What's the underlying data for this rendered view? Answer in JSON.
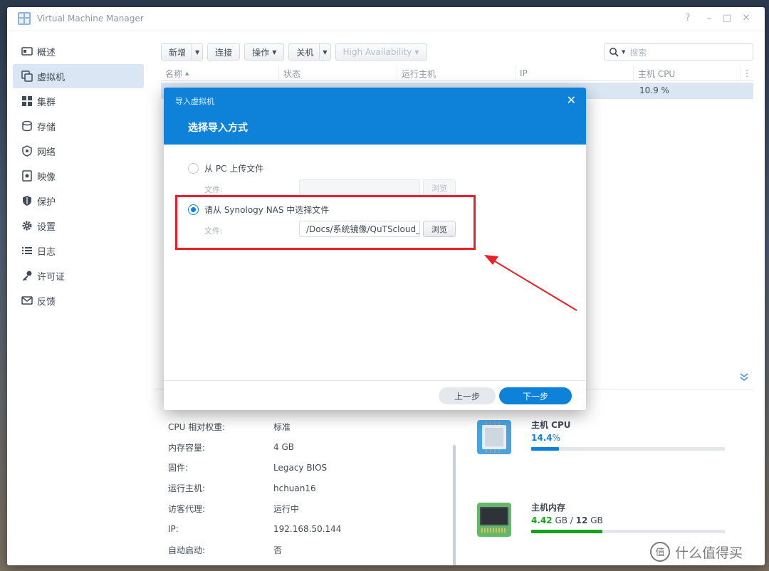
{
  "app": {
    "title": "Virtual Machine Manager"
  },
  "window_controls": {
    "help": "?",
    "minimize": "–",
    "maximize": "□",
    "close": "✕"
  },
  "sidebar": {
    "items": [
      {
        "label": "概述",
        "icon": "overview-icon",
        "active": false
      },
      {
        "label": "虚拟机",
        "icon": "virtual-machine-icon",
        "active": true
      },
      {
        "label": "集群",
        "icon": "cluster-icon",
        "active": false
      },
      {
        "label": "存储",
        "icon": "storage-icon",
        "active": false
      },
      {
        "label": "网络",
        "icon": "network-icon",
        "active": false
      },
      {
        "label": "映像",
        "icon": "image-icon",
        "active": false
      },
      {
        "label": "保护",
        "icon": "shield-icon",
        "active": false
      },
      {
        "label": "设置",
        "icon": "gear-icon",
        "active": false
      },
      {
        "label": "日志",
        "icon": "log-icon",
        "active": false
      },
      {
        "label": "许可证",
        "icon": "key-icon",
        "active": false
      },
      {
        "label": "反馈",
        "icon": "mail-icon",
        "active": false
      }
    ]
  },
  "toolbar": {
    "add": "新增",
    "connect": "连接",
    "action": "操作",
    "shutdown": "关机",
    "ha": "High Availability"
  },
  "search": {
    "placeholder": "搜索"
  },
  "grid": {
    "columns": [
      "名称",
      "状态",
      "运行主机",
      "IP",
      "主机 CPU"
    ],
    "row": {
      "host_cpu": "10.9 %"
    }
  },
  "details": {
    "rows": [
      {
        "key": "CPU 相对权重:",
        "value": "标准"
      },
      {
        "key": "内存容量:",
        "value": "4 GB"
      },
      {
        "key": "固件:",
        "value": "Legacy BIOS"
      },
      {
        "key": "运行主机:",
        "value": "hchuan16"
      },
      {
        "key": "访客代理:",
        "value": "运行中"
      },
      {
        "key": "IP:",
        "value": "192.168.50.144"
      },
      {
        "key": "自动启动:",
        "value": "否"
      }
    ]
  },
  "resources": {
    "cpu": {
      "title": "主机 CPU",
      "value": "14.4",
      "unit": "%",
      "fraction": 0.144,
      "color": "#0e82d8"
    },
    "memory": {
      "title": "主机内存",
      "used": "4.42",
      "used_unit": "GB",
      "separator": "/",
      "total": "12",
      "total_unit": "GB",
      "fraction": 0.368,
      "color": "#17a21a"
    }
  },
  "modal": {
    "title_small": "导入虚拟机",
    "title_big": "选择导入方式",
    "option_pc": "从 PC 上传文件",
    "option_nas": "请从 Synology NAS 中选择文件",
    "file_label": "文件:",
    "browse": "浏览",
    "nas_file_value": "/Docs/系统镜像/QuTScloud_",
    "prev": "上一步",
    "next": "下一步"
  },
  "colors": {
    "accent": "#0e82d8",
    "highlight": "#e8202a"
  },
  "watermark": {
    "text": "什么值得买"
  }
}
